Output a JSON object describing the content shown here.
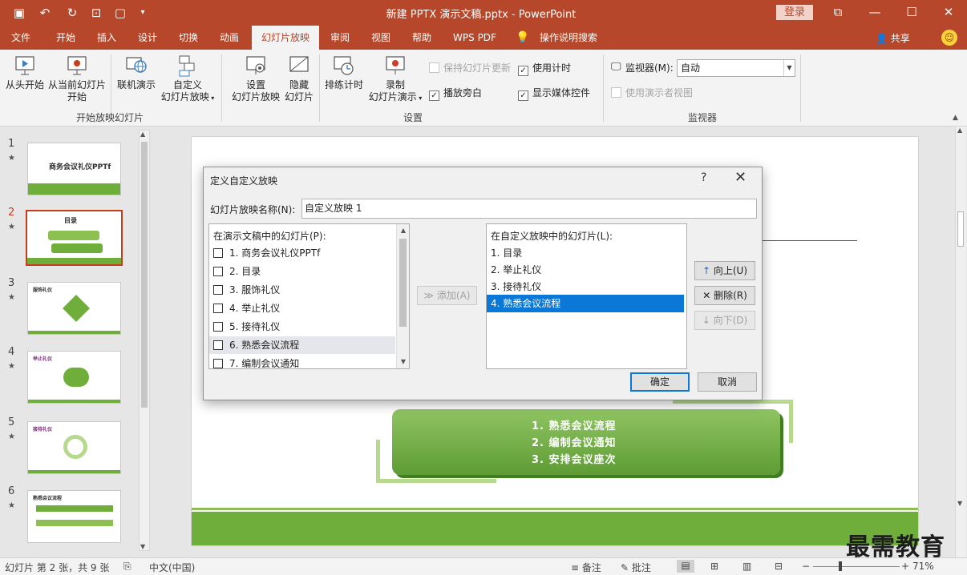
{
  "window": {
    "title": "新建 PPTX 演示文稿.pptx - PowerPoint",
    "login_label": "登录",
    "share_label": "共享"
  },
  "menu": {
    "tabs": [
      {
        "label": "文件",
        "active": false
      },
      {
        "label": "开始",
        "active": false
      },
      {
        "label": "插入",
        "active": false
      },
      {
        "label": "设计",
        "active": false
      },
      {
        "label": "切换",
        "active": false
      },
      {
        "label": "动画",
        "active": false
      },
      {
        "label": "幻灯片放映",
        "active": true
      },
      {
        "label": "审阅",
        "active": false
      },
      {
        "label": "视图",
        "active": false
      },
      {
        "label": "帮助",
        "active": false
      },
      {
        "label": "WPS PDF",
        "active": false
      },
      {
        "label": "操作说明搜索",
        "active": false
      }
    ]
  },
  "ribbon": {
    "start_group": {
      "label": "开始放映幻灯片",
      "from_beginning": "从头开始",
      "from_current_1": "从当前幻灯片",
      "from_current_2": "开始",
      "online_present": "联机演示",
      "custom_show_1": "自定义",
      "custom_show_2": "幻灯片放映"
    },
    "setup_group": {
      "label": "设置",
      "setup_1": "设置",
      "setup_2": "幻灯片放映",
      "hide_1": "隐藏",
      "hide_2": "幻灯片",
      "rehearse": "排练计时",
      "record_1": "录制",
      "record_2": "幻灯片演示",
      "keep_updated": "保持幻灯片更新",
      "play_narrations": "播放旁白",
      "use_timings": "使用计时",
      "show_media_controls": "显示媒体控件"
    },
    "monitor_group": {
      "label": "监视器",
      "monitor_label": "监视器(M):",
      "monitor_value": "自动",
      "presenter_view": "使用演示者视图"
    }
  },
  "slides_panel": {
    "thumbnails": [
      {
        "num": "1",
        "title": "商务会议礼仪PPTf"
      },
      {
        "num": "2",
        "title": "目录"
      },
      {
        "num": "3",
        "title": "服饰礼仪"
      },
      {
        "num": "4",
        "title": "举止礼仪"
      },
      {
        "num": "5",
        "title": "接待礼仪"
      },
      {
        "num": "6",
        "title": "熟悉会议流程"
      }
    ],
    "star": "★"
  },
  "slide_content": {
    "line1": "1.  熟悉会议流程",
    "line2": "2.  编制会议通知",
    "line3": "3.  安排会议座次"
  },
  "dialog": {
    "title": "定义自定义放映",
    "help": "?",
    "close": "✕",
    "name_label": "幻灯片放映名称(N):",
    "name_value": "自定义放映 1",
    "left_header": "在演示文稿中的幻灯片(P):",
    "left_items": [
      "1. 商务会议礼仪PPTf",
      "2. 目录",
      "3. 服饰礼仪",
      "4. 举止礼仪",
      "5. 接待礼仪",
      "6. 熟悉会议流程",
      "7. 编制会议通知"
    ],
    "add_label": "添加(A)",
    "right_header": "在自定义放映中的幻灯片(L):",
    "right_items": [
      "1. 目录",
      "2. 举止礼仪",
      "3. 接待礼仪",
      "4. 熟悉会议流程"
    ],
    "up_label": "向上(U)",
    "remove_label": "删除(R)",
    "down_label": "向下(D)",
    "ok_label": "确定",
    "cancel_label": "取消"
  },
  "statusbar": {
    "slide_info": "幻灯片 第 2 张，共 9 张",
    "language": "中文(中国)",
    "notes": "备注",
    "comments": "批注",
    "zoom": "71%"
  },
  "watermark": "最需教育",
  "colors": {
    "accent": "#b7472a",
    "selection": "#0b78d7",
    "slide_green": "#6fae3a"
  }
}
